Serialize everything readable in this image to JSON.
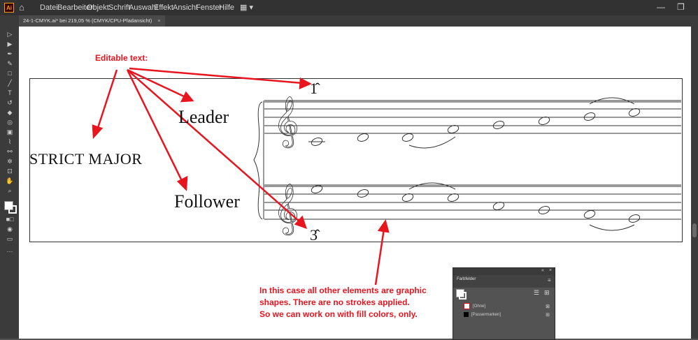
{
  "app": {
    "logo": "Ai",
    "home_icon": "home-icon"
  },
  "menu": {
    "items": [
      "Datei",
      "Bearbeiten",
      "Objekt",
      "Schrift",
      "Auswahl",
      "Effekt",
      "Ansicht",
      "Fenster",
      "Hilfe"
    ]
  },
  "document": {
    "tab_title": "24-1-CMYK.ai* bei 219,05 % (CMYK/CPU-Pfadansicht)",
    "close_symbol": "×"
  },
  "artwork": {
    "heading": "STRICT MAJOR",
    "leader": "Leader",
    "follower": "Follower",
    "degree_top": "1̂",
    "degree_bottom": "3̂"
  },
  "annotations": {
    "editable_text": "Editable text:",
    "note_line1": "In this case all other elements are graphic",
    "note_line2": "shapes. There are no strokes applied.",
    "note_line3": "So we can work on with fill colors, only.",
    "color": "#e8141e"
  },
  "swatches_panel": {
    "title": "Farbfelder",
    "rows": [
      {
        "label": "[Ohne]",
        "color": "none"
      },
      {
        "label": "[Passermarken]",
        "color": "#000000"
      }
    ]
  }
}
